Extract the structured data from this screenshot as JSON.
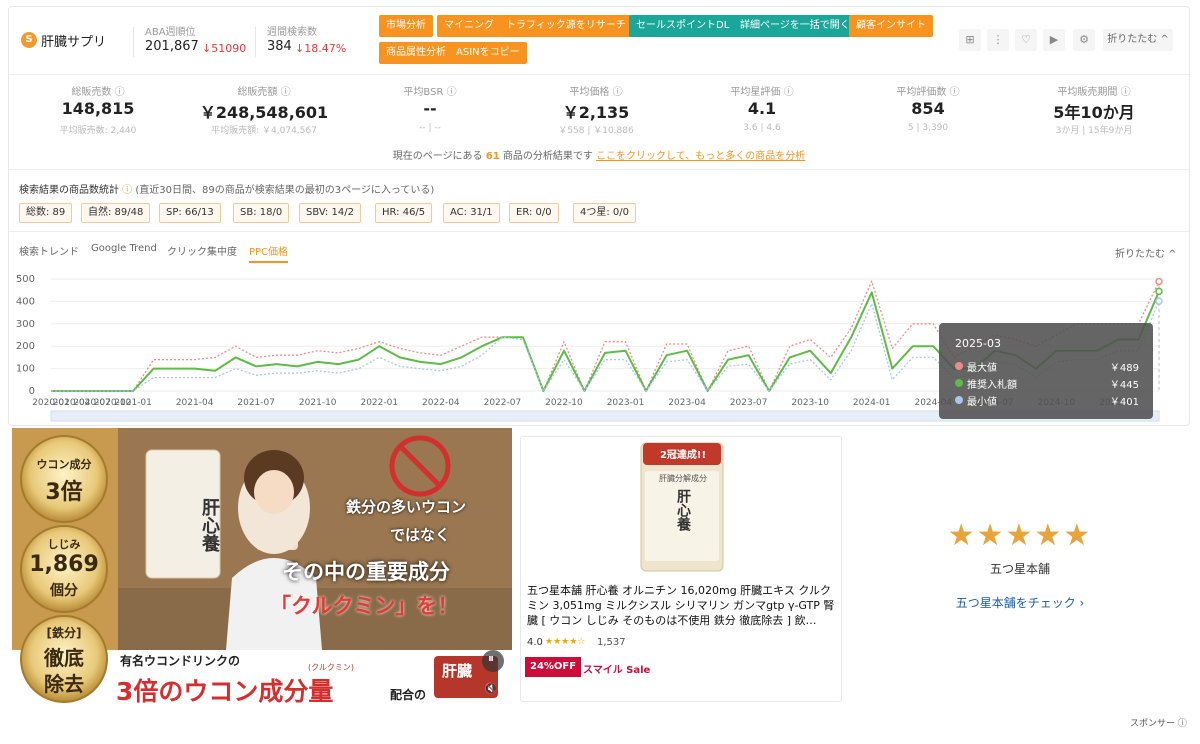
{
  "header": {
    "keyword": "肝臓サプリ",
    "logo_letter": "S",
    "aba_label": "ABA週順位",
    "aba_value": "201,867",
    "aba_change": "↓51090",
    "weekly_label": "週間検索数",
    "weekly_value": "384",
    "weekly_change": "↓18.47%",
    "buttons": [
      "市場分析",
      "マイニング",
      "トラフィック源をリサーチ",
      "セールスポイントDL",
      "詳細ページを一括で開く",
      "顧客インサイト",
      "商品属性分析",
      "ASINをコピー"
    ],
    "fold_label": "折りたたむ ^"
  },
  "metrics": [
    {
      "label": "総販売数 ⓘ",
      "value": "148,815",
      "sub": "平均販売数: 2,440"
    },
    {
      "label": "総販売額 ⓘ",
      "value": "￥248,548,601",
      "sub": "平均販売額: ￥4,074,567"
    },
    {
      "label": "平均BSR ⓘ",
      "value": "--",
      "sub": "-- | --"
    },
    {
      "label": "平均価格 ⓘ",
      "value": "￥2,135",
      "sub": "￥558 | ￥10,886"
    },
    {
      "label": "平均星評価 ⓘ",
      "value": "4.1",
      "sub": "3.6 | 4.6"
    },
    {
      "label": "平均評価数 ⓘ",
      "value": "854",
      "sub": "5 | 3,390"
    },
    {
      "label": "平均販売期間 ⓘ",
      "value": "5年10か月",
      "sub": "3か月 | 15年9か月"
    }
  ],
  "note": {
    "prefix": "現在のページにある",
    "count": "61",
    "middle": "商品の分析結果です",
    "link": "ここをクリックして、もっと多くの商品を分析"
  },
  "stats": {
    "title": "検索結果の商品数統計",
    "help": "ⓘ",
    "subtitle": "(直近30日間、89の商品が検索結果の最初の3ページに入っている)",
    "tags": [
      "総数: 89",
      "自然: 89/48",
      "SP: 66/13",
      "SB: 18/0",
      "SBV: 14/2",
      "HR: 46/5",
      "AC: 31/1",
      "ER: 0/0",
      "4つ星: 0/0"
    ]
  },
  "tabs": [
    "検索トレンド",
    "Google Trend",
    "クリック集中度",
    "PPC価格"
  ],
  "chart_fold": "折りたたむ ^",
  "chart_data": {
    "type": "line",
    "yticks": [
      "500",
      "400",
      "300",
      "200",
      "100",
      "0"
    ],
    "ylim": [
      0,
      500
    ],
    "xticks": [
      "2020-01",
      "2020-04",
      "2020-07",
      "2020-10",
      "2021-01",
      "2021-04",
      "2021-07",
      "2021-10",
      "2022-01",
      "2022-04",
      "2022-07",
      "2022-10",
      "2023-01",
      "2023-04",
      "2023-07",
      "2023-10",
      "2024-01",
      "2024-04",
      "2024-07",
      "2024-10",
      "2025-01"
    ],
    "x": [
      "2020-01",
      "2020-04",
      "2020-07",
      "2020-10",
      "2021-01",
      "2021-02",
      "2021-03",
      "2021-04",
      "2021-05",
      "2021-06",
      "2021-07",
      "2021-08",
      "2021-09",
      "2021-10",
      "2021-11",
      "2021-12",
      "2022-01",
      "2022-02",
      "2022-03",
      "2022-04",
      "2022-05",
      "2022-06",
      "2022-07",
      "2022-08",
      "2022-09",
      "2022-10",
      "2022-11",
      "2022-12",
      "2023-01",
      "2023-02",
      "2023-03",
      "2023-04",
      "2023-05",
      "2023-06",
      "2023-07",
      "2023-08",
      "2023-09",
      "2023-10",
      "2023-11",
      "2023-12",
      "2024-01",
      "2024-02",
      "2024-03",
      "2024-04",
      "2024-05",
      "2024-06",
      "2024-07",
      "2024-08",
      "2024-09",
      "2024-10",
      "2024-11",
      "2024-12",
      "2025-01",
      "2025-02",
      "2025-03"
    ],
    "series": [
      {
        "name": "最大値",
        "color": "#f08a8a",
        "style": "dotted",
        "values": [
          0,
          0,
          0,
          0,
          0,
          140,
          140,
          140,
          150,
          200,
          150,
          160,
          160,
          180,
          170,
          190,
          220,
          190,
          170,
          160,
          200,
          240,
          240,
          240,
          0,
          220,
          0,
          220,
          220,
          0,
          210,
          210,
          0,
          180,
          200,
          0,
          200,
          230,
          150,
          280,
          490,
          190,
          300,
          300,
          150,
          200,
          250,
          230,
          200,
          250,
          300,
          300,
          300,
          300,
          489
        ]
      },
      {
        "name": "推奨入札額",
        "color": "#5dbb46",
        "style": "solid",
        "values": [
          0,
          0,
          0,
          0,
          0,
          100,
          100,
          100,
          90,
          150,
          110,
          120,
          110,
          130,
          120,
          140,
          200,
          150,
          130,
          120,
          150,
          200,
          240,
          240,
          0,
          180,
          0,
          170,
          180,
          0,
          160,
          180,
          0,
          140,
          160,
          0,
          150,
          180,
          80,
          240,
          440,
          100,
          200,
          200,
          100,
          100,
          180,
          160,
          100,
          180,
          180,
          180,
          230,
          230,
          445
        ]
      },
      {
        "name": "最小値",
        "color": "#a9c6ef",
        "style": "dotted",
        "values": [
          0,
          0,
          0,
          0,
          0,
          60,
          60,
          60,
          60,
          100,
          70,
          80,
          80,
          90,
          80,
          100,
          150,
          110,
          100,
          90,
          110,
          160,
          240,
          230,
          0,
          140,
          0,
          140,
          140,
          0,
          130,
          140,
          0,
          110,
          120,
          0,
          120,
          140,
          50,
          180,
          390,
          50,
          150,
          150,
          60,
          70,
          130,
          120,
          60,
          130,
          140,
          140,
          180,
          180,
          401
        ]
      }
    ],
    "grid": true
  },
  "tooltip": {
    "title": "2025-03",
    "rows": [
      {
        "name": "最大値",
        "value": "￥489",
        "color": "#f08a8a"
      },
      {
        "name": "推奨入札額",
        "value": "￥445",
        "color": "#5dbb46"
      },
      {
        "name": "最小値",
        "value": "￥401",
        "color": "#a9c6ef"
      }
    ]
  },
  "ad_video": {
    "badge1_top": "ウコン成分",
    "badge1_bottom": "3倍",
    "badge2_top": "しじみ",
    "badge2_mid": "1,869",
    "badge2_bottom": "個分",
    "badge3_top": "[鉄分]",
    "badge3_mid": "徹底",
    "badge3_bottom": "除去",
    "line1": "鉄分の多いウコン",
    "line2": "ではなく",
    "line3": "その中の重要成分",
    "line4": "「クルクミン」を！",
    "ruby": "(クルクミン)",
    "caption_top": "有名ウコンドリンクの",
    "caption_big": "3倍のウコン成分量",
    "caption_tail": "配合の",
    "pkg_logo": "肝臓",
    "pkg_title": "肝心養"
  },
  "ad_product": {
    "badge": "2冠達成!!",
    "pkg_name": "肝心養",
    "pkg_label": "肝臓分解成分",
    "title": "五つ星本舗 肝心養 オルニチン 16,020mg 肝臓エキス クルクミン 3,051mg ミルクシスル シリマリン ガンマgtp γ-GTP 腎臓 [ ウコン しじみ そのものは不使用 鉄分 徹底除去 ] 飲…",
    "rating": "4.0",
    "stars": "★★★★☆",
    "reviews": "1,537",
    "discount": "24%OFF",
    "sale": "スマイル Sale"
  },
  "ad_brand": {
    "stars": "★★★★★",
    "name": "五つ星本舗",
    "link": "五つ星本舗をチェック ›"
  },
  "sponsor": "スポンサー ⓘ"
}
